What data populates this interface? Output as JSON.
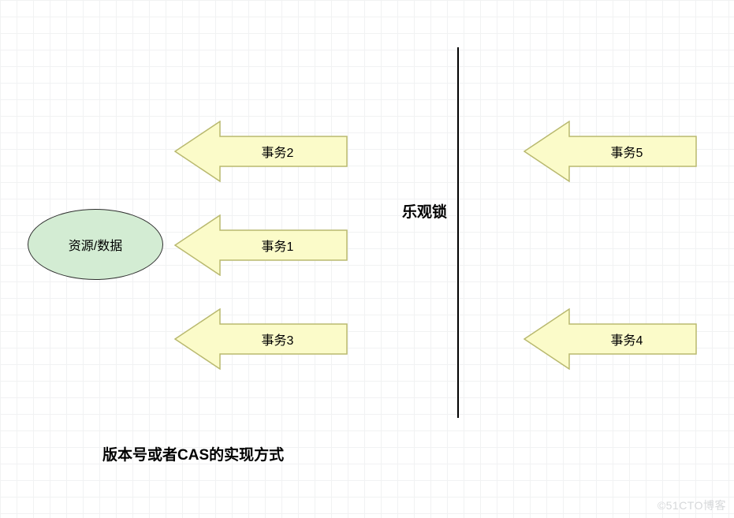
{
  "resource": {
    "label": "资源/数据"
  },
  "arrows": {
    "t2": "事务2",
    "t1": "事务1",
    "t3": "事务3",
    "t5": "事务5",
    "t4": "事务4"
  },
  "lockTitle": "乐观锁",
  "caption": "版本号或者CAS的实现方式",
  "watermark": "©51CTO博客",
  "colors": {
    "arrowFill": "#fbfbc9",
    "arrowStroke": "#b9b96f",
    "ellipseFill": "#d3ecd3"
  }
}
